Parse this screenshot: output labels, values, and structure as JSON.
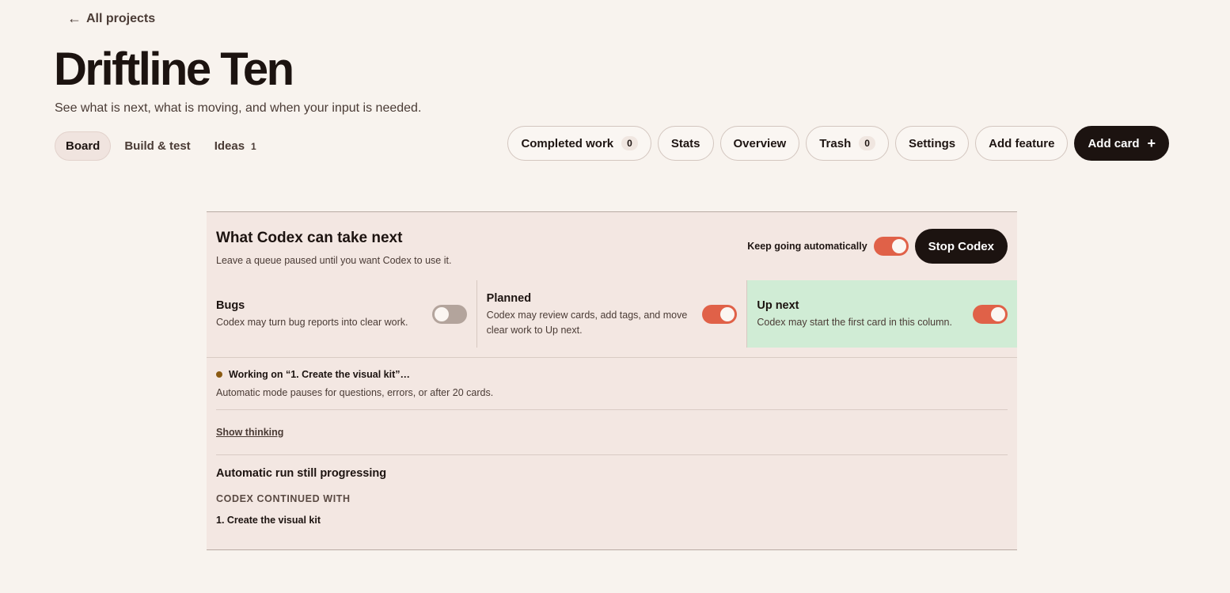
{
  "nav": {
    "back_arrow": "←",
    "back_label": "All projects"
  },
  "header": {
    "title": "Driftline Ten",
    "subtitle": "See what is next, what is moving, and when your input is needed."
  },
  "tabs": [
    {
      "label": "Board",
      "active": true
    },
    {
      "label": "Build & test"
    },
    {
      "label": "Ideas",
      "count": "1"
    }
  ],
  "actions": {
    "completed_work": {
      "label": "Completed work",
      "badge": "0"
    },
    "stats": "Stats",
    "overview": "Overview",
    "trash": {
      "label": "Trash",
      "badge": "0"
    },
    "settings": "Settings",
    "add_feature": "Add feature",
    "add_card": {
      "label": "Add card",
      "icon": "+"
    }
  },
  "panel": {
    "title": "What Codex can take next",
    "description": "Leave a queue paused until you want Codex to use it.",
    "auto_label": "Keep going automatically",
    "auto_on": true,
    "stop_label": "Stop Codex",
    "queues": [
      {
        "name": "Bugs",
        "description": "Codex may turn bug reports into clear work.",
        "enabled": false
      },
      {
        "name": "Planned",
        "description": "Codex may review cards, add tags, and move clear work to Up next.",
        "enabled": true
      },
      {
        "name": "Up next",
        "description": "Codex may start the first card in this column.",
        "enabled": true,
        "highlight": true
      }
    ],
    "status": {
      "working": "Working on “1. Create the visual kit”…",
      "note": "Automatic mode pauses for questions, errors, or after 20 cards."
    },
    "show_thinking": "Show thinking",
    "run": {
      "title": "Automatic run still progressing",
      "kicker": "CODEX CONTINUED WITH",
      "item": "1. Create the visual kit"
    }
  },
  "colors": {
    "background": "#f8f3ee",
    "accent": "#e06148",
    "dark": "#1c1310",
    "highlight": "#d0ecd5",
    "status_dot": "#8a5a12"
  }
}
